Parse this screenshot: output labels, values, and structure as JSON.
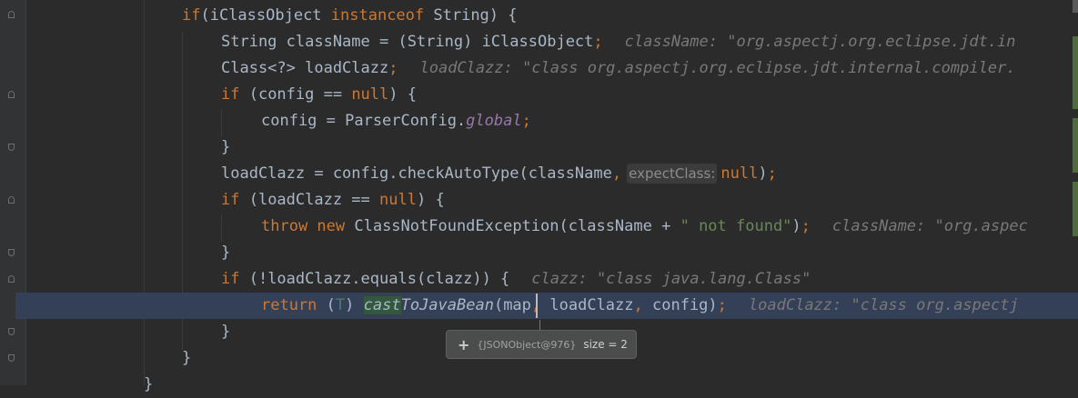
{
  "lines": [
    {
      "id": "l1",
      "tokens": [
        [
          "kw",
          "if"
        ],
        [
          "",
          "(iClassObject "
        ],
        [
          "kw",
          "instanceof"
        ],
        [
          "",
          " String) {"
        ]
      ]
    },
    {
      "id": "l2",
      "tokens": [
        [
          "",
          "String className = (String) iClassObject"
        ],
        [
          "kw",
          ";"
        ]
      ],
      "hint": "className: \"org.aspectj.org.eclipse.jdt.in"
    },
    {
      "id": "l3",
      "tokens": [
        [
          "",
          "Class<?> loadClazz"
        ],
        [
          "kw",
          ";"
        ]
      ],
      "hint": "loadClazz: \"class org.aspectj.org.eclipse.jdt.internal.compiler."
    },
    {
      "id": "l4",
      "tokens": [
        [
          "kw",
          "if"
        ],
        [
          "",
          " (config == "
        ],
        [
          "kw",
          "null"
        ],
        [
          "",
          ") {"
        ]
      ]
    },
    {
      "id": "l5",
      "tokens": [
        [
          "",
          "config = ParserConfig."
        ],
        [
          "static",
          "global"
        ],
        [
          "kw",
          ";"
        ]
      ]
    },
    {
      "id": "l6",
      "tokens": [
        [
          "",
          "}"
        ]
      ]
    },
    {
      "id": "l7",
      "tokens": [
        [
          "",
          "loadClazz = config.checkAutoType(className"
        ],
        [
          "kw",
          ","
        ],
        [
          "param",
          "expectClass:"
        ],
        [
          "kw",
          "null"
        ],
        [
          "",
          ")"
        ],
        [
          "kw",
          ";"
        ]
      ]
    },
    {
      "id": "l8",
      "tokens": [
        [
          "kw",
          "if"
        ],
        [
          "",
          " (loadClazz == "
        ],
        [
          "kw",
          "null"
        ],
        [
          "",
          ") {"
        ]
      ]
    },
    {
      "id": "l9",
      "tokens": [
        [
          "kw",
          "throw new"
        ],
        [
          "",
          " ClassNotFoundException(className + "
        ],
        [
          "str",
          "\" not found\""
        ],
        [
          "",
          ")"
        ],
        [
          "kw",
          ";"
        ]
      ],
      "hint": "className: \"org.aspec"
    },
    {
      "id": "l10",
      "tokens": [
        [
          "",
          "}"
        ]
      ]
    },
    {
      "id": "l11",
      "tokens": [
        [
          "kw",
          "if"
        ],
        [
          "",
          " (!loadClazz.equals(clazz)) {"
        ]
      ],
      "hint": "clazz: \"class java.lang.Class\""
    },
    {
      "id": "l12",
      "tokens": [
        [
          "kw",
          "return"
        ],
        [
          "",
          " ("
        ],
        [
          "typeparam",
          "T"
        ],
        [
          "",
          ") "
        ],
        [
          "usage",
          "cast"
        ],
        [
          "italic",
          "ToJavaBean"
        ],
        [
          "",
          "(map"
        ],
        [
          "kw",
          ","
        ],
        [
          "",
          " loadClazz"
        ],
        [
          "kw",
          ","
        ],
        [
          "",
          " config)"
        ],
        [
          "kw",
          ";"
        ]
      ],
      "hint": "loadClazz: \"class org.aspectj"
    },
    {
      "id": "l13",
      "tokens": [
        [
          "",
          "}"
        ]
      ]
    },
    {
      "id": "l14",
      "tokens": [
        [
          "",
          "}"
        ]
      ]
    },
    {
      "id": "l15",
      "tokens": [
        [
          "",
          "}"
        ]
      ]
    }
  ],
  "tooltip": {
    "plus": "+",
    "object": "{JSONObject@976}",
    "size": "size = 2"
  },
  "colors": {
    "background": "#2b2b2b",
    "keyword": "#cc7832",
    "string": "#6a8759",
    "static_field": "#9876aa",
    "current_line": "#344057"
  }
}
